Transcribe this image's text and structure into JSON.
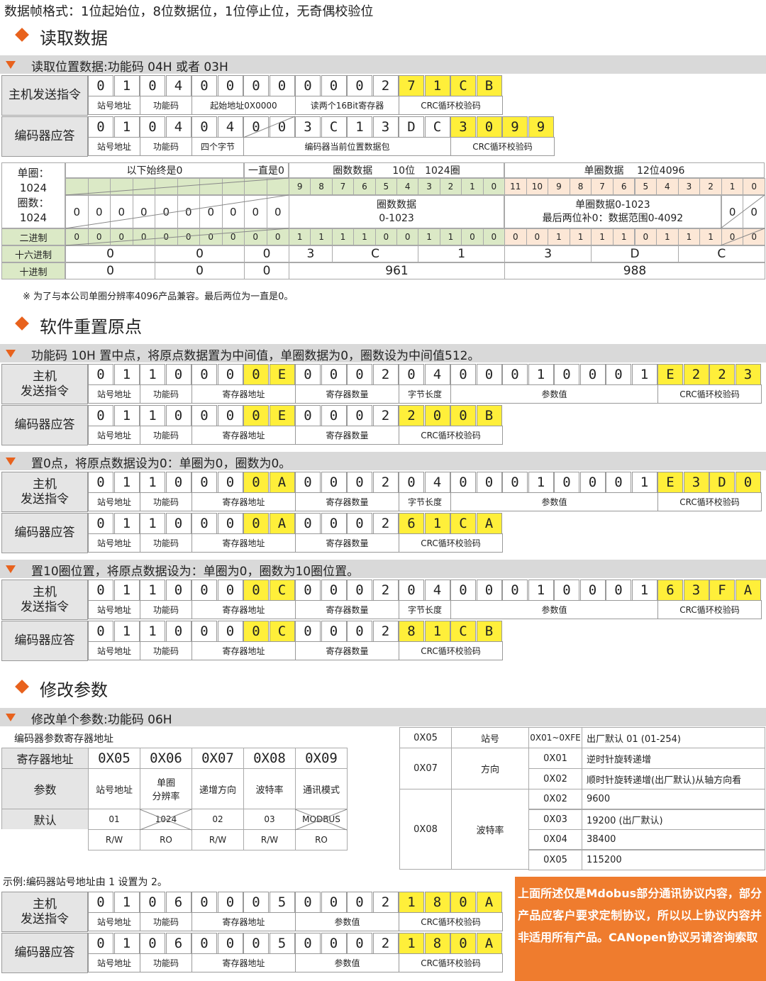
{
  "intro": "数据帧格式：1位起始位，8位数据位，1位停止位，无奇偶校验位",
  "sections": {
    "read": "读取数据",
    "reset": "软件重置原点",
    "modify": "修改参数"
  },
  "bars": {
    "read": "读取位置数据:功能码 04H 或者 03H",
    "reset10": "功能码 10H 置中点，将原点数据置为中间值，单圈数据为0，圈数设为中间值512。",
    "zero": "置0点，将原点数据设为0：单圈为0，圈数为0。",
    "ten": "置10圈位置，将原点数据设为：单圈为0，圈数为10圈位置。",
    "modify": "修改单个参数:功能码 06H"
  },
  "labels": {
    "host": "主机发送指令",
    "host2": "主机\n发送指令",
    "enc": "编码器应答"
  },
  "read_send": {
    "digits": [
      "0",
      "1",
      "0",
      "4",
      "0",
      "0",
      "0",
      "0",
      "0",
      "0",
      "0",
      "2",
      "7",
      "1",
      "C",
      "B"
    ],
    "sub": [
      "站号地址",
      "功能码",
      "起始地址0X0000",
      "读两个16Bit寄存器",
      "CRC循环校验码"
    ]
  },
  "read_resp": {
    "digits": [
      "0",
      "1",
      "0",
      "4",
      "0",
      "4",
      "0",
      "0",
      "3",
      "C",
      "1",
      "3",
      "D",
      "C",
      "3",
      "0",
      "9",
      "9"
    ],
    "sub": [
      "站号地址",
      "功能码",
      "四个字节",
      "编码器当前位置数据包",
      "CRC循环校验码"
    ]
  },
  "bit_table": {
    "left": [
      "单圈：",
      "1024",
      "圈数：",
      "1024"
    ],
    "head": [
      "以下始终是0",
      "一直是0",
      "圈数数据　　10位　1024圈",
      "单圈数据　 12位4096"
    ],
    "turn_bits": [
      "9",
      "8",
      "7",
      "6",
      "5",
      "4",
      "3",
      "2",
      "1",
      "0"
    ],
    "single_bits": [
      "11",
      "10",
      "9",
      "8",
      "7",
      "6",
      "5",
      "4",
      "3",
      "2",
      "1",
      "0"
    ],
    "zeros": "0",
    "turn_desc": [
      "圈数数据",
      "0-1023"
    ],
    "single_desc": [
      "单圈数据0-1023",
      "最后两位补0：数据范围0-4092"
    ],
    "row_bin": "二进制",
    "row_hex": "十六进制",
    "row_dec": "十进制",
    "bin_turn": [
      "1",
      "1",
      "1",
      "1",
      "0",
      "0",
      "1",
      "1",
      "0",
      "0"
    ],
    "bin_single": [
      "0",
      "0",
      "1",
      "1",
      "1",
      "1",
      "0",
      "1",
      "1",
      "1",
      "0",
      "0"
    ],
    "hex": [
      "0",
      "0",
      "0",
      "3",
      "C",
      "1",
      "3",
      "D",
      "C"
    ],
    "dec": [
      "0",
      "0",
      "0",
      "961",
      "988"
    ]
  },
  "footnote": "※ 为了与本公司单圈分辨率4096产品兼容。最后两位为一直是0。",
  "reset_send": {
    "digits": [
      "0",
      "1",
      "1",
      "0",
      "0",
      "0",
      "0",
      "E",
      "0",
      "0",
      "0",
      "2",
      "0",
      "4",
      "0",
      "0",
      "0",
      "1",
      "0",
      "0",
      "0",
      "1",
      "E",
      "2",
      "2",
      "3"
    ],
    "sub": [
      "站号地址",
      "功能码",
      "寄存器地址",
      "寄存器数量",
      "字节长度",
      "参数值",
      "CRC循环校验码"
    ]
  },
  "reset_resp": {
    "digits": [
      "0",
      "1",
      "1",
      "0",
      "0",
      "0",
      "0",
      "E",
      "0",
      "0",
      "0",
      "2",
      "2",
      "0",
      "0",
      "B"
    ],
    "sub": [
      "站号地址",
      "功能码",
      "寄存器地址",
      "寄存器数量",
      "CRC循环校验码"
    ]
  },
  "zero_send": {
    "digits": [
      "0",
      "1",
      "1",
      "0",
      "0",
      "0",
      "0",
      "A",
      "0",
      "0",
      "0",
      "2",
      "0",
      "4",
      "0",
      "0",
      "0",
      "1",
      "0",
      "0",
      "0",
      "1",
      "E",
      "3",
      "D",
      "0"
    ]
  },
  "zero_resp": {
    "digits": [
      "0",
      "1",
      "1",
      "0",
      "0",
      "0",
      "0",
      "A",
      "0",
      "0",
      "0",
      "2",
      "6",
      "1",
      "C",
      "A"
    ]
  },
  "ten_send": {
    "digits": [
      "0",
      "1",
      "1",
      "0",
      "0",
      "0",
      "0",
      "C",
      "0",
      "0",
      "0",
      "2",
      "0",
      "4",
      "0",
      "0",
      "0",
      "1",
      "0",
      "0",
      "0",
      "1",
      "6",
      "3",
      "F",
      "A"
    ]
  },
  "ten_resp": {
    "digits": [
      "0",
      "1",
      "1",
      "0",
      "0",
      "0",
      "0",
      "C",
      "0",
      "0",
      "0",
      "2",
      "8",
      "1",
      "C",
      "B"
    ]
  },
  "param": {
    "title": "编码器参数寄存器地址",
    "head": [
      "寄存器地址",
      "0X05",
      "0X06",
      "0X07",
      "0X08",
      "0X09"
    ],
    "row_param": [
      "参数",
      "站号地址",
      "单圈\n分辨率",
      "递增方向",
      "波特率",
      "通讯模式"
    ],
    "row_def": [
      "默认",
      "01",
      "1024",
      "02",
      "03",
      "MODBUS"
    ],
    "row_rw": [
      "R/W",
      "RO",
      "R/W",
      "R/W",
      "RO"
    ]
  },
  "right_table": {
    "r05": [
      "0X05",
      "站号",
      "0X01~0XFE",
      "出厂默认 01 (01-254)"
    ],
    "r07": [
      "0X07",
      "方向"
    ],
    "dir": [
      [
        "0X01",
        "逆时针旋转递增"
      ],
      [
        "0X02",
        "顺时针旋转递增(出厂默认)从轴方向看"
      ]
    ],
    "r08": [
      "0X08",
      "波特率"
    ],
    "baud": [
      [
        "0X02",
        "9600"
      ],
      [
        "0X03",
        "19200 (出厂默认)"
      ],
      [
        "0X04",
        "38400"
      ],
      [
        "0X05",
        "115200"
      ]
    ]
  },
  "example": "示例:编码器站号地址由 1 设置为 2。",
  "ex_send": {
    "digits": [
      "0",
      "1",
      "0",
      "6",
      "0",
      "0",
      "0",
      "5",
      "0",
      "0",
      "0",
      "2",
      "1",
      "8",
      "0",
      "A"
    ],
    "sub": [
      "站号地址",
      "功能码",
      "寄存器地址",
      "参数值",
      "CRC循环校验码"
    ]
  },
  "ex_resp": {
    "digits": [
      "0",
      "1",
      "0",
      "6",
      "0",
      "0",
      "0",
      "5",
      "0",
      "0",
      "0",
      "2",
      "1",
      "8",
      "0",
      "A"
    ]
  },
  "notice": "上面所述仅是Mdobus部分通讯协议内容，部分产品应客户要求定制协议，所以以上协议内容并非适用所有产品。CANopen协议另请咨询索取"
}
